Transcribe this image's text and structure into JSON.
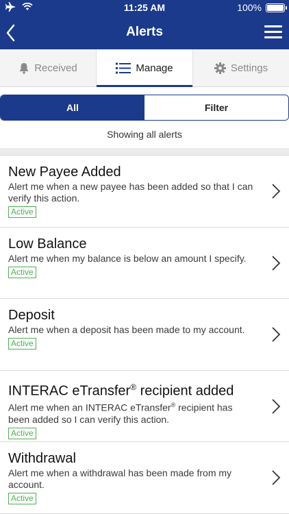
{
  "status_bar": {
    "time": "11:25 AM",
    "battery": "100%"
  },
  "header": {
    "title": "Alerts"
  },
  "tabs": [
    {
      "label": "Received",
      "icon": "bell-icon"
    },
    {
      "label": "Manage",
      "icon": "list-icon"
    },
    {
      "label": "Settings",
      "icon": "gear-icon"
    }
  ],
  "filter": {
    "all_label": "All",
    "filter_label": "Filter"
  },
  "showing_text": "Showing all alerts",
  "alerts": [
    {
      "title": "New Payee Added",
      "desc": "Alert me when a new payee has been added so that I can verify this action.",
      "status": "Active"
    },
    {
      "title": "Low Balance",
      "desc": "Alert me when my balance is below an amount I specify.",
      "status": "Active"
    },
    {
      "title": "Deposit",
      "desc": "Alert me when a deposit has been made to my account.",
      "status": "Active"
    },
    {
      "title_pre": "INTERAC eTransfer",
      "title_post": " recipient added",
      "desc_pre": "Alert me when an INTERAC eTransfer",
      "desc_post": " recipient has been added so I can verify this action.",
      "reg": "®",
      "status": "Active"
    },
    {
      "title": "Withdrawal",
      "desc": "Alert me when a withdrawal has been made from my account.",
      "status": "Active"
    }
  ],
  "colors": {
    "brand": "#1b3a8c",
    "active_badge": "#4caf50"
  }
}
